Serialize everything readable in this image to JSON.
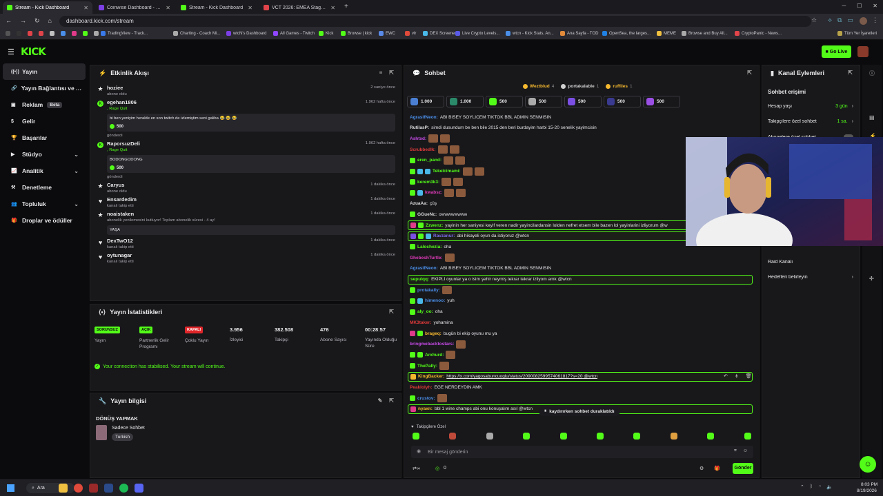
{
  "browser": {
    "tabs": [
      {
        "title": "Stream - Kick Dashboard",
        "active": true,
        "fav": "#53fc18"
      },
      {
        "title": "Coinwise Dashboard - BTC Cryp",
        "active": false,
        "fav": "#7b3fe4"
      },
      {
        "title": "Stream - Kick Dashboard",
        "active": false,
        "fav": "#53fc18"
      },
      {
        "title": "VCT 2026: EMEA Stage 2: Brack",
        "active": false,
        "fav": "#e0444a"
      }
    ],
    "url": "dashboard.kick.com/stream",
    "bookmarks": [
      "TradingView - Track...",
      "Charting - Coach Mi...",
      "wtcN's Dashboard",
      "All Games - Twitch",
      "Kick",
      "Browse | kick",
      "EWC",
      "vlr",
      "DEX Screener",
      "Live Crypto Levels...",
      "wtcn - Kick Stats, An...",
      "Ana Sayfa - TOD",
      "OpenSea, the larges...",
      "MEME",
      "Browse and Buy All...",
      "CryptoPanic - News..."
    ],
    "bookmarks_all": "Tüm Yer İşaretleri"
  },
  "topnav": {
    "logo": "KICK",
    "go_live": "Go Live"
  },
  "sidebar": [
    {
      "label": "Yayın",
      "icon": "broadcast-icon",
      "active": true
    },
    {
      "label": "Yayın Bağlantısı ve Anahtarı",
      "icon": "link-icon"
    },
    {
      "label": "Reklam",
      "icon": "ad-icon",
      "badge": "Beta"
    },
    {
      "label": "Gelir",
      "icon": "dollar-icon"
    },
    {
      "label": "Başarılar",
      "icon": "trophy-icon"
    },
    {
      "label": "Stüdyo",
      "icon": "video-icon",
      "chevron": true
    },
    {
      "label": "Analitik",
      "icon": "chart-icon",
      "chevron": true
    },
    {
      "label": "Denetleme",
      "icon": "hammer-icon"
    },
    {
      "label": "Topluluk",
      "icon": "users-icon",
      "chevron": true
    },
    {
      "label": "Droplar ve ödüller",
      "icon": "gift-icon"
    }
  ],
  "activity": {
    "title": "Etkinlik Akışı",
    "events": [
      {
        "name": "hoziee",
        "sub": "abone oldu",
        "time": "2 saniye önce",
        "type": "star"
      },
      {
        "name": "egehan1806",
        "sub": ", Rage Quit",
        "time": "1.962 hafta önce",
        "type": "kick",
        "box": "bi ben yeniyim heralde en son twitch de izlemiştim seni galiba 😂 😂 😂",
        "amount": "500",
        "after": "gönderdi"
      },
      {
        "name": "RaporsuzDeli",
        "sub": ", Rage Quit",
        "time": "1.962 hafta önce",
        "type": "kick",
        "box": "BODONGODONG",
        "amount": "500",
        "after": "gönderdi"
      },
      {
        "name": "Caryus",
        "sub": "abone oldu",
        "time": "1 dakika önce",
        "type": "star"
      },
      {
        "name": "Ensardedim",
        "sub": "kanalı takip etti",
        "time": "1 dakika önce",
        "type": "heart"
      },
      {
        "name": "noaistaken",
        "sub": "abonelik yenilemesini kutluyor! Toplam abonelik süresi - 4 ay!",
        "time": "1 dakika önce",
        "type": "star",
        "box": "YAŞA"
      },
      {
        "name": "DexTwO12",
        "sub": "kanalı takip etti",
        "time": "1 dakika önce",
        "type": "heart"
      },
      {
        "name": "oytunagar",
        "sub": "kanalı takip etti",
        "time": "1 dakika önce",
        "type": "heart"
      }
    ]
  },
  "stats": {
    "title": "Yayın İstatistikleri",
    "items": [
      {
        "badge": "SORUNSUZ",
        "label": "Yayın",
        "color": "#53fc18"
      },
      {
        "badge": "AÇIK",
        "label": "Partnerlik Gelir Programı",
        "color": "#53fc18"
      },
      {
        "badge": "KAPALI",
        "label": "Çoklu Yayın",
        "color": "#e0262a"
      },
      {
        "value": "3.956",
        "label": "İzleyici"
      },
      {
        "value": "382.508",
        "label": "Takipçi"
      },
      {
        "value": "476",
        "label": "Abone Sayısı"
      },
      {
        "value": "00:28:57",
        "label": "Yayında Olduğu Süre"
      }
    ],
    "notice": "Your connection has stabilised. Your stream will continue."
  },
  "info": {
    "title": "Yayın bilgisi",
    "stream_title": "DÖNÜŞ YAPMAK",
    "category": "Sadece Sohbet",
    "tag": "Turkish"
  },
  "chat": {
    "title": "Sohbet",
    "leaders": [
      {
        "name": "Weztblud",
        "n": "4",
        "color": "#f5b82e"
      },
      {
        "name": "portakalable",
        "n": "1",
        "color": "#d0d0d0"
      },
      {
        "name": "ruffiles",
        "n": "1",
        "color": "#f5b82e"
      }
    ],
    "gifts": [
      {
        "amount": "1.000",
        "color": "#4a7fd4"
      },
      {
        "amount": "1.000",
        "color": "#2a8a6a"
      },
      {
        "amount": "500",
        "color": "#53fc18"
      },
      {
        "amount": "500",
        "color": "#aaaaaa"
      },
      {
        "amount": "500",
        "color": "#7b4fe4"
      },
      {
        "amount": "500",
        "color": "#3a3a90"
      },
      {
        "amount": "500",
        "color": "#9b4fe4"
      }
    ],
    "messages": [
      {
        "user": "AgrasifNeon",
        "color": "#4a8ee8",
        "msg": "ABI BISEY SOYLICEM TIKTOK BBL ADMIN SENMISIN"
      },
      {
        "user": "RutilasP",
        "color": "#dddddd",
        "msg": "simdi dusundum be ben bile 2015 den beri burdayim harbi 15-20 senelik yayimcisin"
      },
      {
        "user": "Ashtxd",
        "color": "#c84ae8",
        "emotes": 2
      },
      {
        "user": "Scrubbedlk",
        "color": "#e03a3a",
        "emotes": 2
      },
      {
        "user": "eren_pand",
        "color": "#53fc18",
        "badges": [
          "#53fc18"
        ],
        "emotes": 2
      },
      {
        "user": "Tekelcimami",
        "color": "#53fc18",
        "badges": [
          "#53fc18",
          "#4ab8e8",
          "#4ab8e8"
        ],
        "emotes": 2
      },
      {
        "user": "kerem3k3",
        "color": "#53fc18",
        "badges": [
          "#53fc18"
        ],
        "emotes": 2
      },
      {
        "user": "kwabsz",
        "color": "#e03ab8",
        "badges": [
          "#53fc18",
          "#4ab8e8"
        ],
        "emotes": 2
      },
      {
        "user": "AzuaAa",
        "color": "#dddddd",
        "msg": "çüş"
      },
      {
        "user": "GGueNc",
        "color": "#dddddd",
        "badges": [
          "#53fc18"
        ],
        "msg": "owwwwwwww"
      },
      {
        "user": "Zzwenz",
        "color": "#53fc18",
        "badges": [
          "#e03a8a",
          "#53fc18"
        ],
        "msg": "yayinin her saniyesi keyif veren nadir yayincilardansin lolden nefret etsem bile bazen lol yayinlarini izliyorum @w",
        "hl": true
      },
      {
        "user": "Ravzanur",
        "color": "#7b6ae8",
        "badges": [
          "#7b4fe4",
          "#53fc18",
          "#4ab8e8"
        ],
        "msg": "abi hikayeli oyun da istiyoruz @wtcn",
        "hl": true
      },
      {
        "user": "Lalochezia",
        "color": "#53fc18",
        "badges": [
          "#53fc18"
        ],
        "msg": "oha"
      },
      {
        "user": "GhebeshTurtle",
        "color": "#e03ab8",
        "emotes": 1
      },
      {
        "user": "AgrasifNeon",
        "color": "#4a8ee8",
        "msg": "ABI BISEY SOYLICEM TIKTOK BBL ADMIN SENMISIN"
      },
      {
        "user": "sepulqq",
        "color": "#53fc18",
        "msg": "EKİPLİ oyunlar ya o isim şehir neymiş tekrar tekrar izliyom amk @wtcn",
        "hl": true
      },
      {
        "user": "protakally",
        "color": "#4a8ee8",
        "badges": [
          "#53fc18"
        ],
        "emotes": 1
      },
      {
        "user": "himenoo",
        "color": "#4a8ee8",
        "badges": [
          "#53fc18",
          "#4ab8e8"
        ],
        "msg": "yuh"
      },
      {
        "user": "aly_oo",
        "color": "#53fc18",
        "badges": [
          "#53fc18"
        ],
        "msg": "oha"
      },
      {
        "user": "MK3taker",
        "color": "#e03a3a",
        "msg": "yohamina"
      },
      {
        "user": "brageq",
        "color": "#f5b82e",
        "badges": [
          "#e03a8a",
          "#53fc18"
        ],
        "msg": "bugün bi ekip oyunu mu ya"
      },
      {
        "user": "bringmebacktostars",
        "color": "#c84ae8",
        "emotes": 1
      },
      {
        "user": "Arxhurd",
        "color": "#53fc18",
        "badges": [
          "#53fc18",
          "#53fc18"
        ],
        "emotes": 1
      },
      {
        "user": "ThePally",
        "color": "#53fc18",
        "badges": [
          "#53fc18"
        ],
        "emotes": 1
      },
      {
        "user": "KingBacker",
        "color": "#f5b82e",
        "badges": [
          "#f5b82e"
        ],
        "msg": "https://x.com/yagosabuncuoglu/status/2090082599574061817?s=20 @wtcn",
        "hl": true,
        "link": true
      },
      {
        "user": "Peaklolyh",
        "color": "#e03a3a",
        "msg": "EGE NERDEYDİN AMK"
      },
      {
        "user": "crustov",
        "color": "#4a8ee8",
        "badges": [
          "#53fc18"
        ],
        "emotes": 1
      },
      {
        "user": "nyaxn",
        "color": "#f5b82e",
        "badges": [
          "#e03a8a"
        ],
        "msg": "bbl 1 wine champs abi onu konuşalım asıl @wtcn",
        "hl": true
      }
    ],
    "paused": "kaydırırken sohbet duraklatıldı",
    "followers_only": "Takipçilere Özel",
    "placeholder": "Bir mesaj gönderin",
    "points": "0",
    "send": "Gönder"
  },
  "channel": {
    "title": "Kanal Eylemleri",
    "section": "Sohbet erişimi",
    "rows": [
      {
        "label": "Hesap yaşı",
        "value": "3 gün",
        "chev": true
      },
      {
        "label": "Takipçilere özel sohbet",
        "value": "1 sa.",
        "chev": true
      },
      {
        "label": "Abonelere özel sohbet",
        "toggle": true
      },
      {
        "label": "Raid Kanalı"
      },
      {
        "label": "Hedefleri belirleyin",
        "chev": true
      }
    ]
  },
  "taskbar": {
    "search": "Ara",
    "time": "8:03 PM",
    "date": "8/19/2026"
  }
}
